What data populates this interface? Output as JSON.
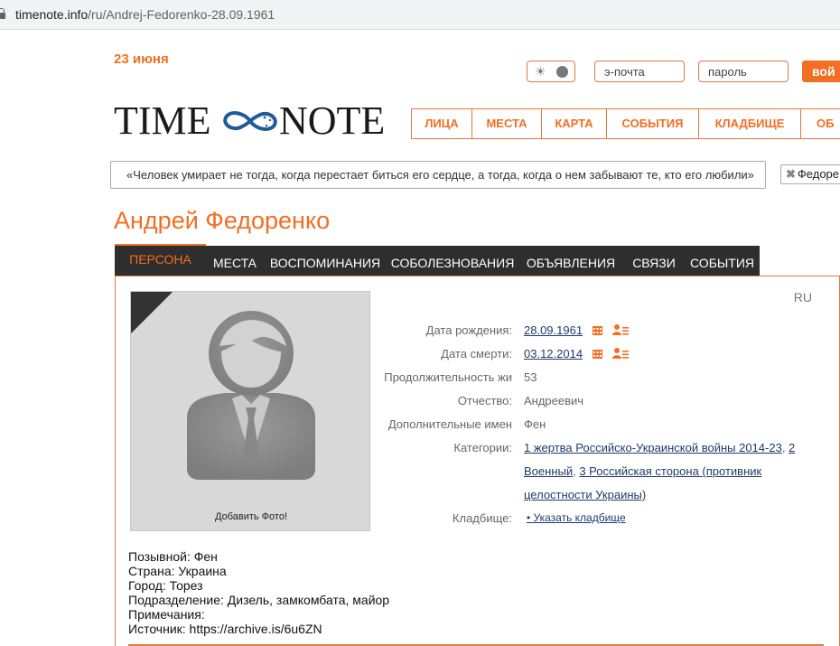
{
  "browser": {
    "url_host": "timenote.info",
    "url_path": "/ru/Andrej-Fedorenko-28.09.1961"
  },
  "header": {
    "date": "23 июня",
    "email_placeholder": "э-почта",
    "password_placeholder": "пароль",
    "login_label": "вой",
    "logo_left": "TIME",
    "logo_right": "NOTE",
    "nav": [
      "ЛИЦА",
      "МЕСТА",
      "КАРТА",
      "СОБЫТИЯ",
      "КЛАДБИЩЕ",
      "ОБ"
    ]
  },
  "quote": "«Человек умирает не тогда, когда перестает биться его сердце, а тогда, когда о нем забывают те, кто его любили»",
  "search_chip": "Федоре",
  "person": {
    "name": "Андрей Федоренко",
    "tabs": [
      "ПЕРСОНА",
      "МЕСТА",
      "ВОСПОМИНАНИЯ",
      "СОБОЛЕЗНОВАНИЯ",
      "ОБЪЯВЛЕНИЯ",
      "СВЯЗИ",
      "СОБЫТИЯ"
    ],
    "lang": "RU",
    "add_photo": "Добавить Фото!",
    "info": {
      "birth_label": "Дата рождения:",
      "birth_value": "28.09.1961",
      "death_label": "Дата смерти:",
      "death_value": "03.12.2014",
      "duration_label": "Продолжительность жи",
      "duration_value": "53",
      "patronymic_label": "Отчество:",
      "patronymic_value": "Андреевич",
      "extra_names_label": "Дополнительные имен",
      "extra_names_value": "Фен",
      "categories_label": "Категории:",
      "cat1": "1 жертва Российско-Украинской войны 2014-23",
      "cat2": "2",
      "cat2_rest": "Военный",
      "cat3a": "3 Российская сторона (противник",
      "cat3b": "целостности Украины)",
      "cemetery_label": "Кладбище:",
      "cemetery_value": "• Указать кладбище"
    },
    "details": [
      "Позывной: Фен",
      "Страна: Украина",
      "Город: Торез",
      "Подразделение: Дизель, замкомбата, майор",
      "Примечания:",
      "Источник: https://archive.is/6u6ZN"
    ]
  },
  "colors": {
    "accent": "#f26e22",
    "tab_bar": "#2e2e2e",
    "link": "#1f3b6b"
  }
}
